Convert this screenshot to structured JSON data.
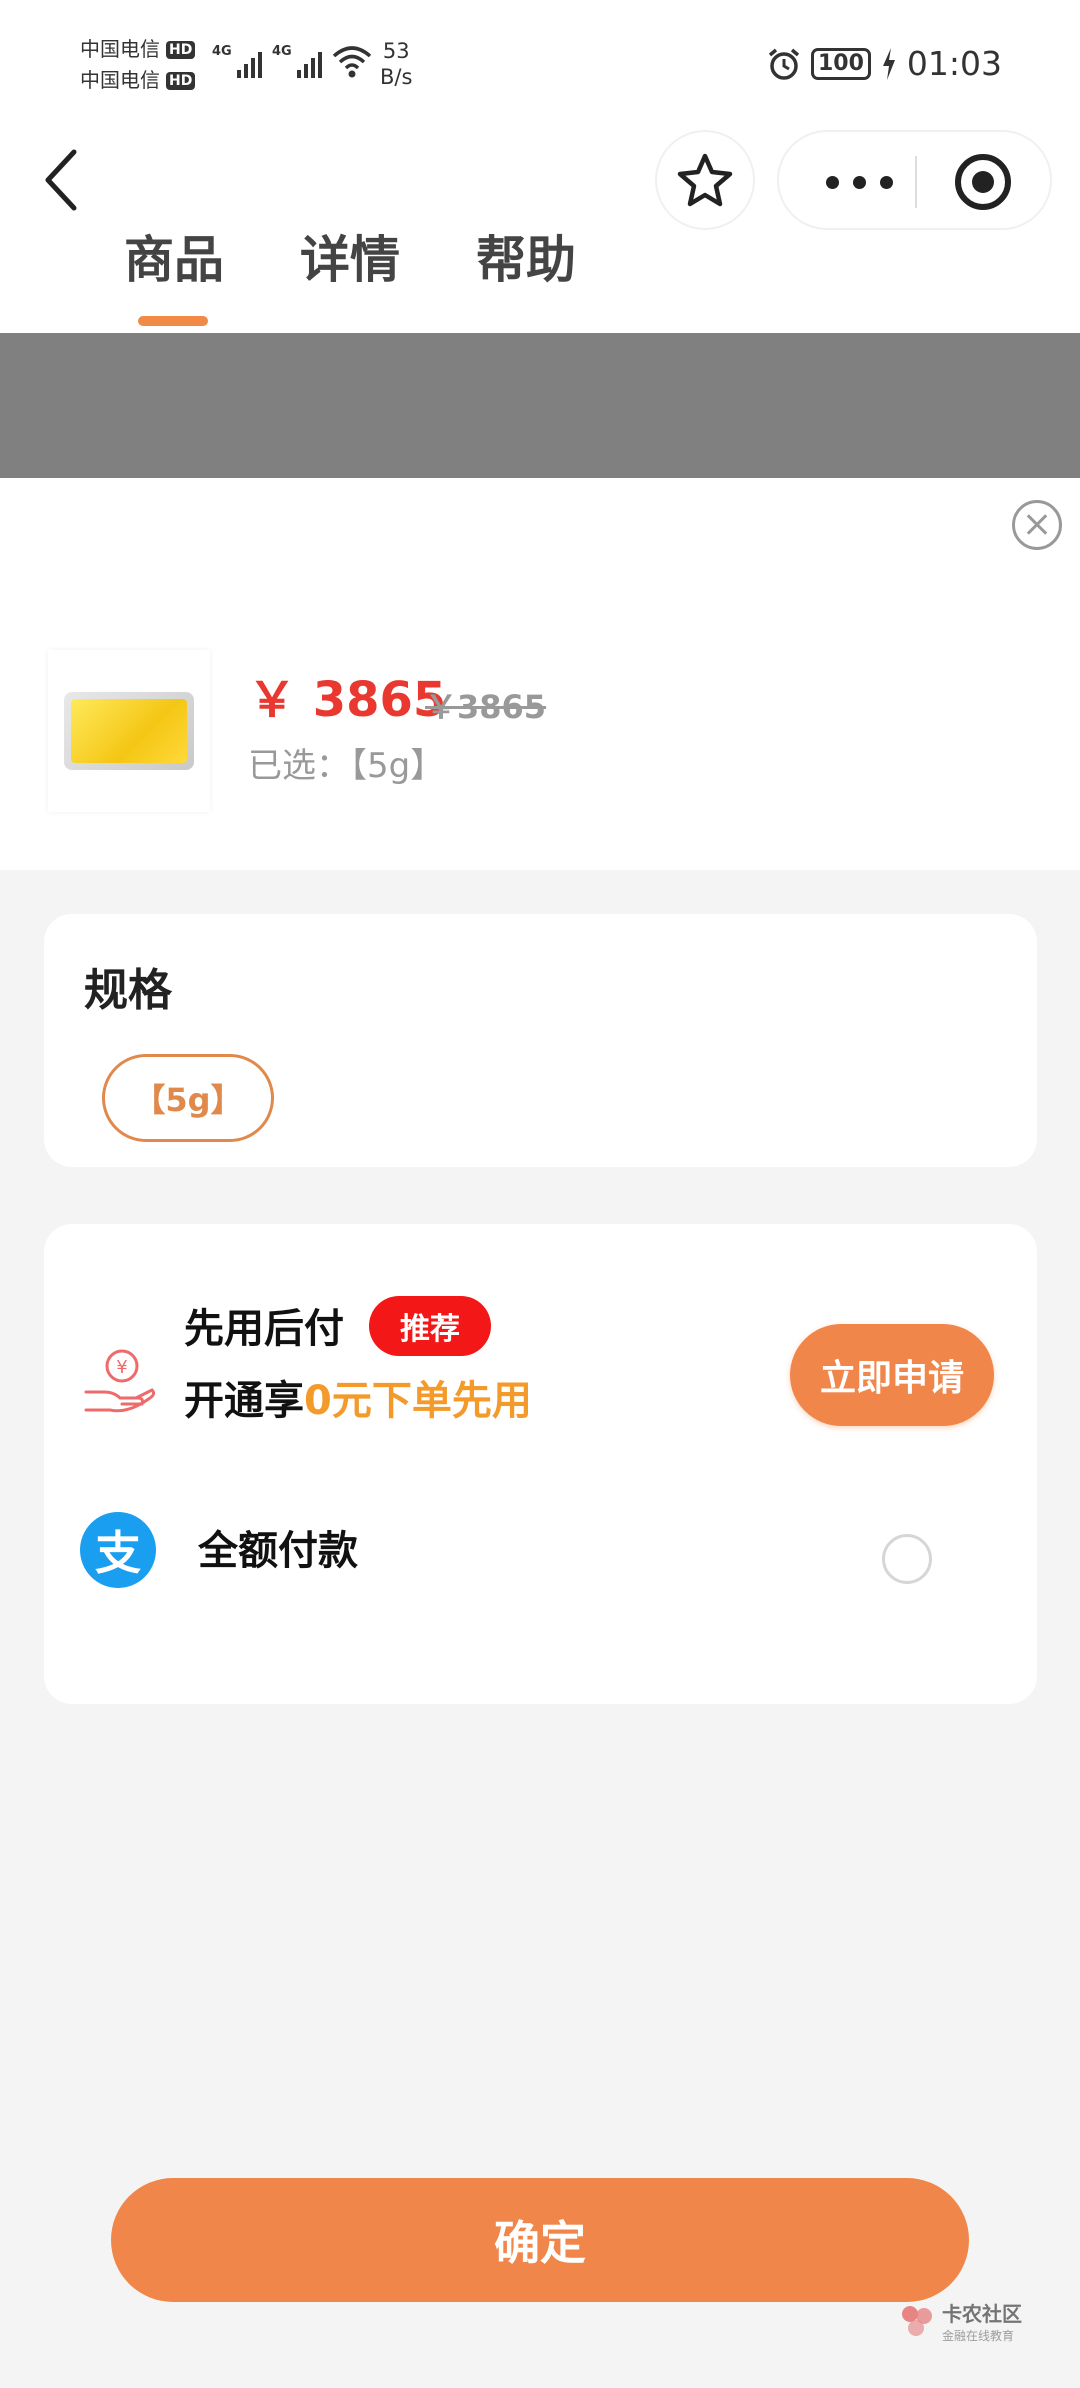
{
  "status_bar": {
    "carrier_1": "中国电信",
    "carrier_2": "中国电信",
    "hd_label": "HD",
    "network_label": "4G",
    "speed_value": "53",
    "speed_unit": "B/s",
    "battery": "100",
    "time": "01:03"
  },
  "nav": {
    "tabs": [
      {
        "label": "商品",
        "active": true
      },
      {
        "label": "详情",
        "active": false
      },
      {
        "label": "帮助",
        "active": false
      }
    ],
    "icons": [
      "back-icon",
      "star-icon",
      "more-icon",
      "target-icon"
    ]
  },
  "product": {
    "price": "￥ 3865",
    "original_price": "￥3865",
    "selected_text": "已选：【5g】"
  },
  "spec": {
    "title": "规格",
    "option": "【5g】"
  },
  "payment": {
    "bnpl_title": "先用后付",
    "bnpl_badge": "推荐",
    "bnpl_sub_prefix": "开通享",
    "bnpl_sub_highlight": "0元下单先用",
    "apply_label": "立即申请",
    "alipay_glyph": "支",
    "full_payment_label": "全额付款"
  },
  "confirm_label": "确定",
  "watermark": {
    "main": "卡农社区",
    "sub": "金融在线教育"
  },
  "colors": {
    "accent": "#f0864a",
    "price": "#e8382f",
    "badge": "#f41717",
    "highlight": "#f39a2a",
    "alipay": "#1a9ff0"
  }
}
